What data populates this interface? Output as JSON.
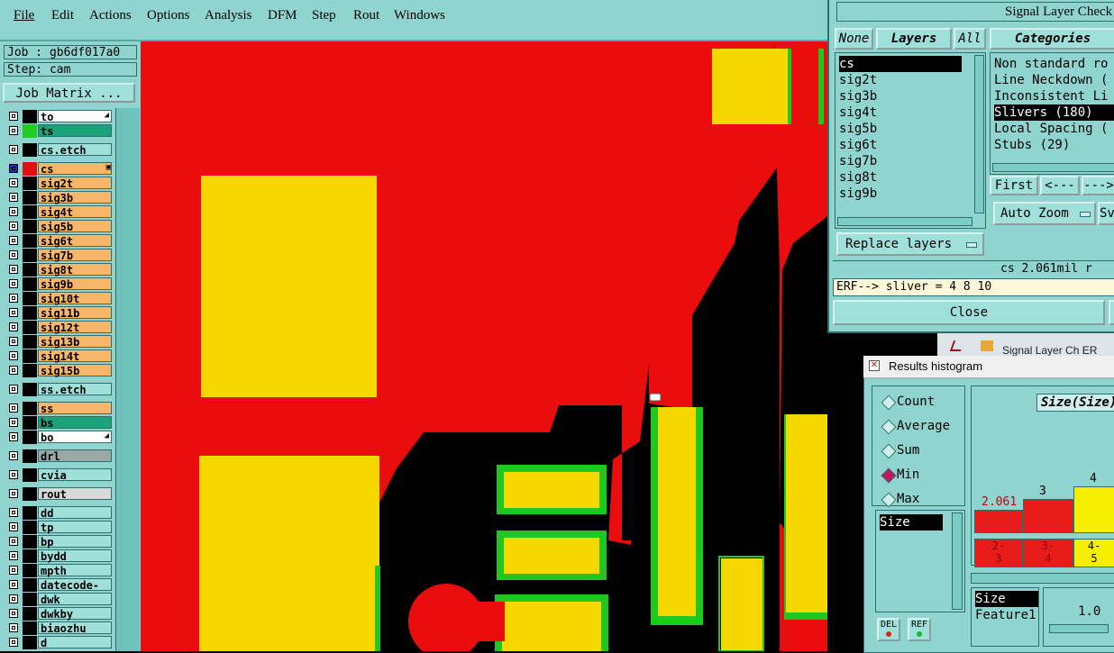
{
  "menu": [
    "File",
    "Edit",
    "Actions",
    "Options",
    "Analysis",
    "DFM",
    "Step",
    "Rout",
    "Windows"
  ],
  "job": "Job : gb6df017a0",
  "step": "Step: cam",
  "job_matrix_label": "Job Matrix ...",
  "layers": [
    {
      "name": "to",
      "color": "#ffffff",
      "sw": "#000000"
    },
    {
      "name": "ts",
      "color": "#1aa37a",
      "sw": "#22cc22"
    },
    {
      "name": "cs.etch",
      "color": "#9fe0db",
      "sw": "#000000"
    },
    {
      "name": "cs",
      "color": "#f7b66a",
      "sw": "#e01010"
    },
    {
      "name": "sig2t",
      "color": "#f7b66a",
      "sw": "#000000"
    },
    {
      "name": "sig3b",
      "color": "#f7b66a",
      "sw": "#000000"
    },
    {
      "name": "sig4t",
      "color": "#f7b66a",
      "sw": "#000000"
    },
    {
      "name": "sig5b",
      "color": "#f7b66a",
      "sw": "#000000"
    },
    {
      "name": "sig6t",
      "color": "#f7b66a",
      "sw": "#000000"
    },
    {
      "name": "sig7b",
      "color": "#f7b66a",
      "sw": "#000000"
    },
    {
      "name": "sig8t",
      "color": "#f7b66a",
      "sw": "#000000"
    },
    {
      "name": "sig9b",
      "color": "#f7b66a",
      "sw": "#000000"
    },
    {
      "name": "sig10t",
      "color": "#f7b66a",
      "sw": "#000000"
    },
    {
      "name": "sig11b",
      "color": "#f7b66a",
      "sw": "#000000"
    },
    {
      "name": "sig12t",
      "color": "#f7b66a",
      "sw": "#000000"
    },
    {
      "name": "sig13b",
      "color": "#f7b66a",
      "sw": "#000000"
    },
    {
      "name": "sig14t",
      "color": "#f7b66a",
      "sw": "#000000"
    },
    {
      "name": "sig15b",
      "color": "#f7b66a",
      "sw": "#000000"
    },
    {
      "name": "ss.etch",
      "color": "#9fe0db",
      "sw": "#000000"
    },
    {
      "name": "ss",
      "color": "#f7b66a",
      "sw": "#000000"
    },
    {
      "name": "bs",
      "color": "#1aa37a",
      "sw": "#000000"
    },
    {
      "name": "bo",
      "color": "#ffffff",
      "sw": "#000000"
    },
    {
      "name": "drl",
      "color": "#9aa8a6",
      "sw": "#000000"
    },
    {
      "name": "cvia",
      "color": "#9fe0db",
      "sw": "#000000"
    },
    {
      "name": "rout",
      "color": "#d9d9d9",
      "sw": "#000000"
    },
    {
      "name": "dd",
      "color": "#9fe0db",
      "sw": "#000000"
    },
    {
      "name": "tp",
      "color": "#9fe0db",
      "sw": "#000000"
    },
    {
      "name": "bp",
      "color": "#9fe0db",
      "sw": "#000000"
    },
    {
      "name": "bydd",
      "color": "#9fe0db",
      "sw": "#000000"
    },
    {
      "name": "mpth",
      "color": "#9fe0db",
      "sw": "#000000"
    },
    {
      "name": "datecode-pto",
      "color": "#9fe0db",
      "sw": "#000000"
    },
    {
      "name": "dwk",
      "color": "#9fe0db",
      "sw": "#000000"
    },
    {
      "name": "dwkby",
      "color": "#9fe0db",
      "sw": "#000000"
    },
    {
      "name": "biaozhu",
      "color": "#9fe0db",
      "sw": "#000000"
    },
    {
      "name": "d",
      "color": "#9fe0db",
      "sw": "#000000"
    }
  ],
  "signal_dialog": {
    "title": "Signal Layer Check",
    "btn_none": "None",
    "btn_layers": "Layers",
    "btn_all": "All",
    "layer_list": [
      "cs",
      "sig2t",
      "sig3b",
      "sig4t",
      "sig5b",
      "sig6t",
      "sig7b",
      "sig8t",
      "sig9b"
    ],
    "categories_label": "Categories",
    "categories": [
      "Non standard ro",
      "Line Neckdown (",
      "Inconsistent Li",
      "Slivers (180)",
      "Local Spacing (",
      "Stubs (29)"
    ],
    "first_label": "First",
    "prev_label": "<---",
    "next_label": "--->",
    "auto_zoom_label": "Auto Zoom",
    "sv_label": "Sv",
    "replace_layers_label": "Replace layers",
    "status_text": "cs 2.061mil  r",
    "erf_text": "ERF--> sliver = 4 8 10",
    "close_label": "Close",
    "bg_title": "Signal Layer Ch ER"
  },
  "histogram": {
    "title": "Results histogram",
    "options": [
      "Count",
      "Average",
      "Sum",
      "Min",
      "Max"
    ],
    "selected": "Min",
    "size_label": "Size",
    "size_list": [
      "Size",
      "Feature1"
    ],
    "header": "Size(Size)",
    "del_label": "DEL",
    "ref_label": "REF",
    "bar_labels": [
      "2.061",
      "3",
      "4"
    ],
    "bins": [
      "2-\n3",
      "3-\n4",
      "4-\n5"
    ],
    "scale": "1.0"
  }
}
